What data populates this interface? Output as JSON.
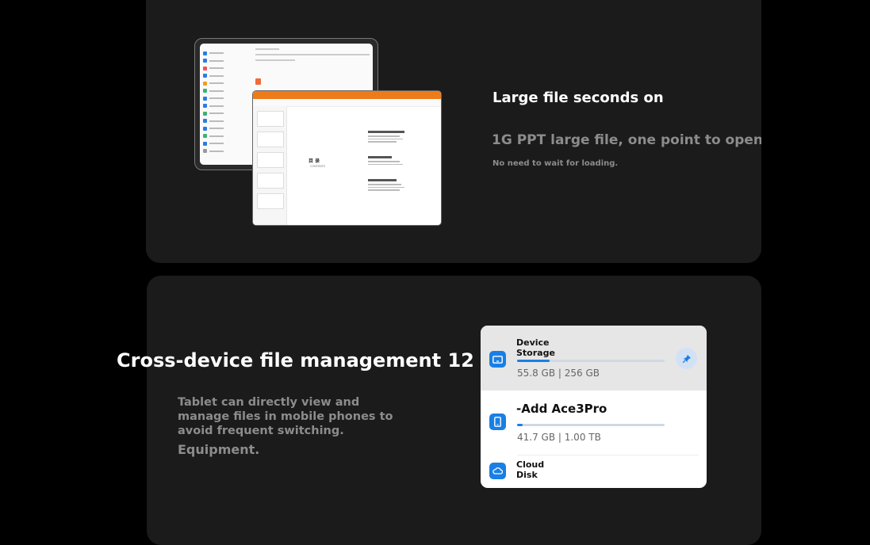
{
  "card1": {
    "title": "Large file seconds on",
    "subtitle": "1G PPT large file, one point to open,",
    "note": "No need to wait for loading.",
    "slide_title": "目 录",
    "slide_subtitle": "CONTENTS"
  },
  "card2": {
    "title": "Cross-device file management 12",
    "description": "Tablet can directly view and manage files in mobile phones to avoid frequent switching.",
    "equipment": "Equipment."
  },
  "storage": {
    "rows": [
      {
        "name": "Device Storage",
        "size": "55.8 GB | 256 GB",
        "used_fraction": 0.22,
        "icon": "tablet-icon"
      },
      {
        "name": "-Add Ace3Pro",
        "size": "41.7 GB | 1.00 TB",
        "used_fraction": 0.04,
        "icon": "phone-icon"
      },
      {
        "name": "Cloud Disk",
        "icon": "cloud-icon"
      }
    ],
    "accent": "#1a7fe4",
    "pin_icon": "pin-icon"
  }
}
